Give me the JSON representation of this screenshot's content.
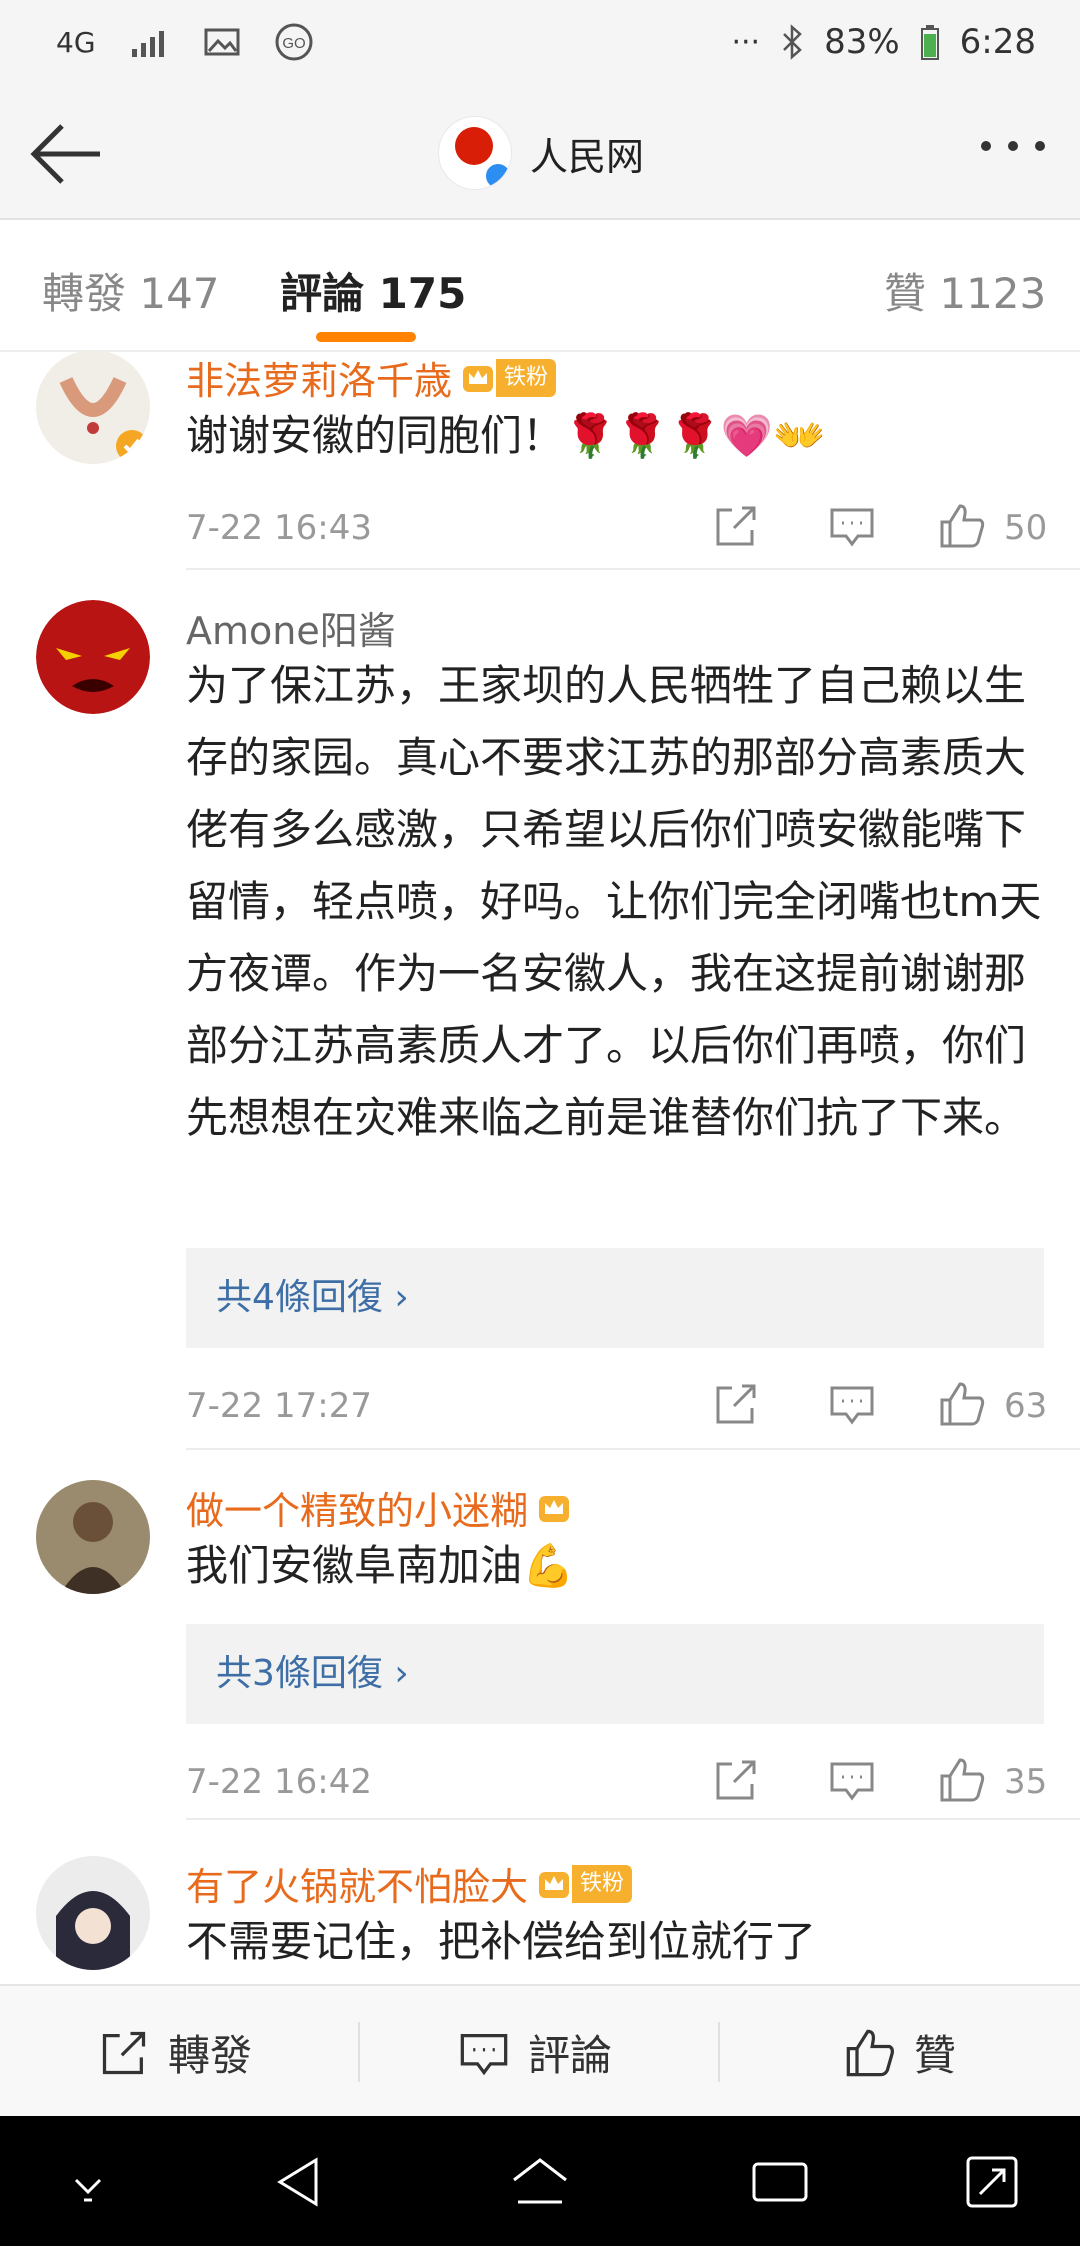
{
  "status_bar": {
    "network": "4G",
    "battery": "83%",
    "time": "6:28"
  },
  "header": {
    "title": "人民网"
  },
  "tabs": {
    "repost": "轉發 147",
    "comments": "評論 175",
    "likes": "贊 1123"
  },
  "comments": [
    {
      "username": "非法萝莉洛千歳",
      "badge": "铁粉",
      "text": "谢谢安徽的同胞们！🌹🌹🌹💗👐",
      "time": "7-22 16:43",
      "likes": "50"
    },
    {
      "username": "Amone阳酱",
      "text": "为了保江苏，王家坝的人民牺牲了自己赖以生存的家园。真心不要求江苏的那部分高素质大佬有多么感激，只希望以后你们喷安徽能嘴下留情，轻点喷，好吗。让你们完全闭嘴也tm天方夜谭。作为一名安徽人，我在这提前谢谢那部分江苏高素质人才了。以后你们再喷，你们先想想在灾难来临之前是谁替你们抗了下来。",
      "replies": "共4條回復 ›",
      "time": "7-22 17:27",
      "likes": "63"
    },
    {
      "username": "做一个精致的小迷糊",
      "text": "我们安徽阜南加油💪",
      "replies": "共3條回復 ›",
      "time": "7-22 16:42",
      "likes": "35"
    },
    {
      "username": "有了火锅就不怕脸大",
      "badge": "铁粉",
      "text": "不需要记住，把补偿给到位就行了"
    }
  ],
  "action_bar": {
    "repost": "轉發",
    "comment": "評論",
    "like": "贊"
  },
  "colors": {
    "accent": "#ff8200",
    "username": "#e86b1d",
    "link": "#3e6ea6"
  }
}
